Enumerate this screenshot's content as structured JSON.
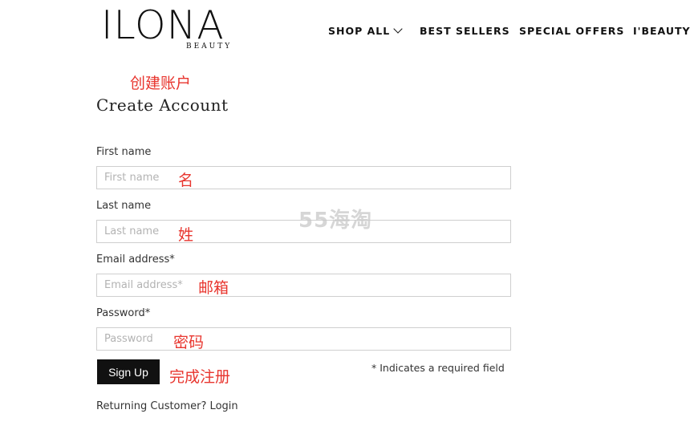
{
  "brand": {
    "name": "ILONA",
    "sub": "BEAUTY"
  },
  "nav": {
    "shop_all": "SHOP ALL",
    "best_sellers": "BEST SELLERS",
    "special_offers": "SPECIAL OFFERS",
    "ibeauty": "I'BEAUTY"
  },
  "annotations": {
    "create_account": "创建账户",
    "first_name": "名",
    "last_name": "姓",
    "email": "邮箱",
    "password": "密码",
    "sign_up": "完成注册"
  },
  "form": {
    "title": "Create Account",
    "first_name_label": "First name",
    "first_name_placeholder": "First name",
    "last_name_label": "Last name",
    "last_name_placeholder": "Last name",
    "email_label": "Email address*",
    "email_placeholder": "Email address*",
    "password_label": "Password*",
    "password_placeholder": "Password",
    "sign_up_button": "Sign Up",
    "required_note": "* Indicates a required field",
    "returning_link": "Returning Customer? Login"
  },
  "watermark": "55海淘",
  "colors": {
    "annotation": "#e8352e",
    "button": "#111111"
  }
}
